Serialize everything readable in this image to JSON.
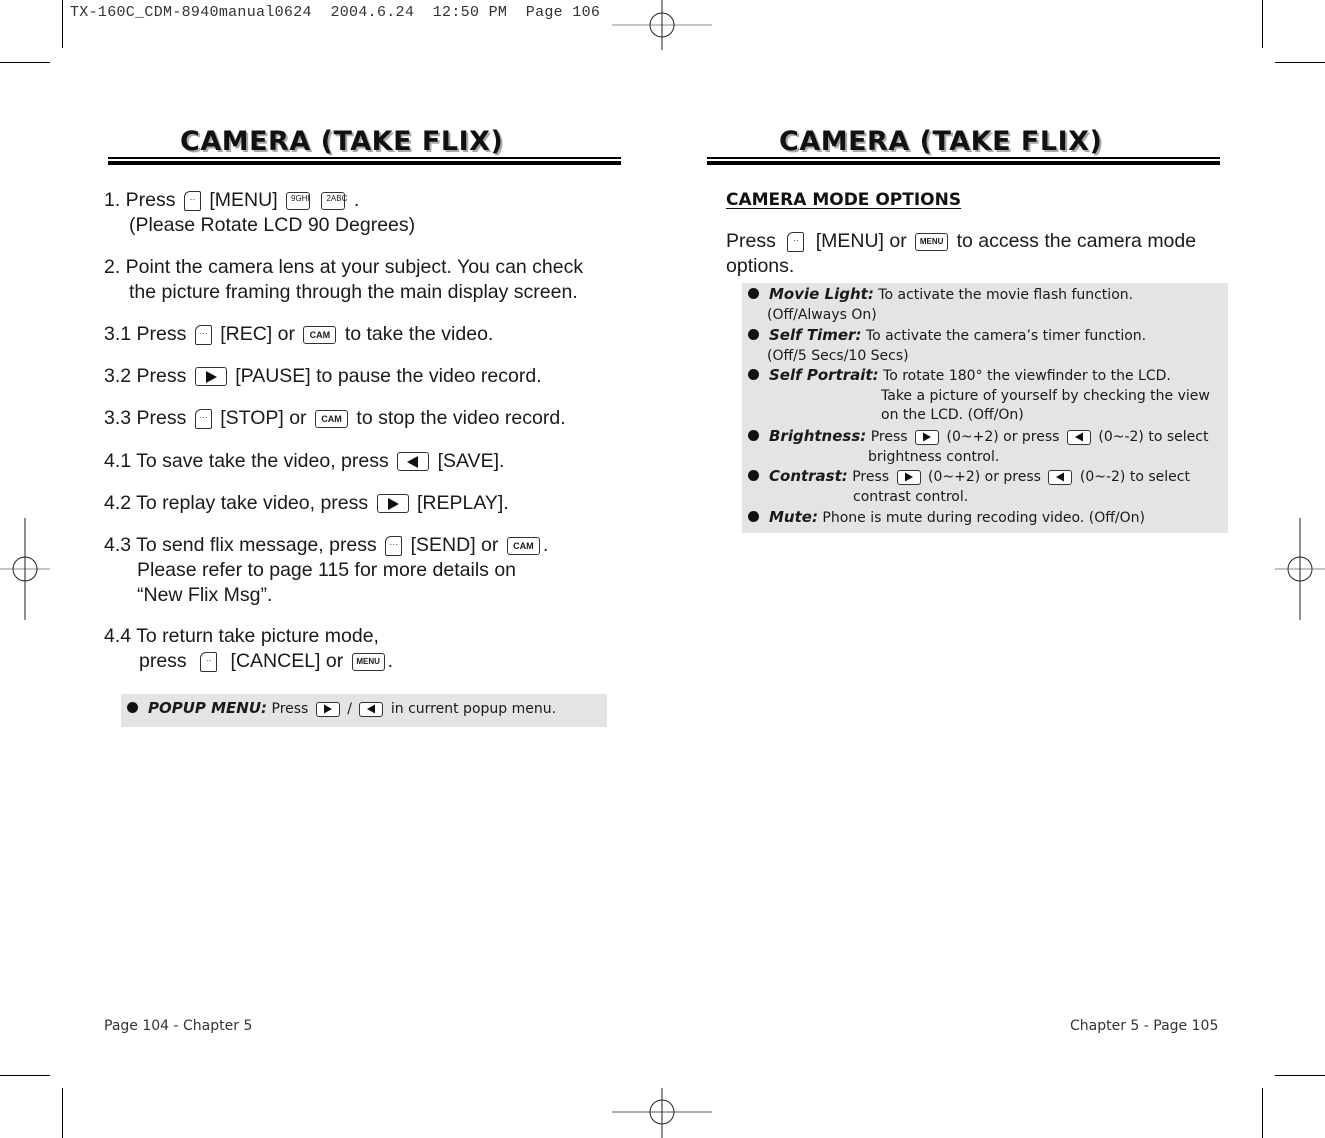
{
  "print_header": "TX-160C_CDM-8940manual0624  2004.6.24  12:50 PM  Page 106",
  "left_page": {
    "title": "CAMERA (TAKE FLIX)",
    "steps": {
      "s1_a": "1. Press",
      "s1_b": "[MENU]",
      "s1_c": ".",
      "s1_line2": "(Please Rotate LCD 90 Degrees)",
      "s2_line1": "2. Point the camera lens at your subject. You can check",
      "s2_line2": "the picture framing through the main display screen.",
      "s31_a": "3.1 Press",
      "s31_b": "[REC] or",
      "s31_c": "to take the video.",
      "s32_a": "3.2 Press",
      "s32_b": "[PAUSE] to pause the video record.",
      "s33_a": "3.3 Press",
      "s33_b": "[STOP] or",
      "s33_c": "to stop the video record.",
      "s41_a": "4.1 To save take the video, press",
      "s41_b": "[SAVE].",
      "s42_a": "4.2 To replay take video, press",
      "s42_b": "[REPLAY].",
      "s43_a": "4.3 To send flix message, press",
      "s43_b": "[SEND] or",
      "s43_c": ".",
      "s43_line2": "Please refer to page 115 for more details on",
      "s43_line3": "“New Flix Msg”.",
      "s44_line1": "4.4 To return take picture mode,",
      "s44_a": "press",
      "s44_b": "[CANCEL] or",
      "s44_c": "."
    },
    "popup_note": {
      "label": "POPUP MENU:",
      "text_a": "Press",
      "text_b": "/",
      "text_c": "in current popup menu."
    },
    "footer": "Page 104 - Chapter 5"
  },
  "right_page": {
    "title": "CAMERA (TAKE FLIX)",
    "section_heading": "CAMERA MODE OPTIONS",
    "intro_a": "Press",
    "intro_b": "[MENU] or",
    "intro_c": "to access the camera mode",
    "intro_line2": "options.",
    "options": [
      {
        "label": "Movie Light:",
        "text": "To activate the movie flash function.",
        "line2": "(Off/Always On)"
      },
      {
        "label": "Self Timer:",
        "text": "To activate the camera’s timer function.",
        "line2": "(Off/5 Secs/10 Secs)"
      },
      {
        "label": "Self Portrait:",
        "text": "To rotate 180° the viewfinder to the LCD.",
        "line2": "Take a picture of yourself by checking the view",
        "line3": "on the LCD. (Off/On)"
      },
      {
        "label": "Brightness:",
        "text_a": "Press",
        "text_b": "(0~+2) or press",
        "text_c": "(0~-2) to select",
        "line2": "brightness control."
      },
      {
        "label": "Contrast:",
        "text_a": "Press",
        "text_b": "(0~+2) or press",
        "text_c": "(0~-2) to select",
        "line2": "contrast control."
      },
      {
        "label": "Mute:",
        "text": "Phone is mute during recoding video. (Off/On)"
      }
    ],
    "footer": "Chapter 5 - Page 105"
  },
  "keys": {
    "cam": "CAM",
    "menu": "MENU",
    "nine": "9GHI",
    "two": "2ABC"
  },
  "icons": {
    "left_soft_key": "left-softkey-icon",
    "right_soft_key": "right-softkey-icon",
    "nav_right": "nav-right-icon",
    "nav_left": "nav-left-icon",
    "registration_mark": "registration-mark-icon"
  }
}
